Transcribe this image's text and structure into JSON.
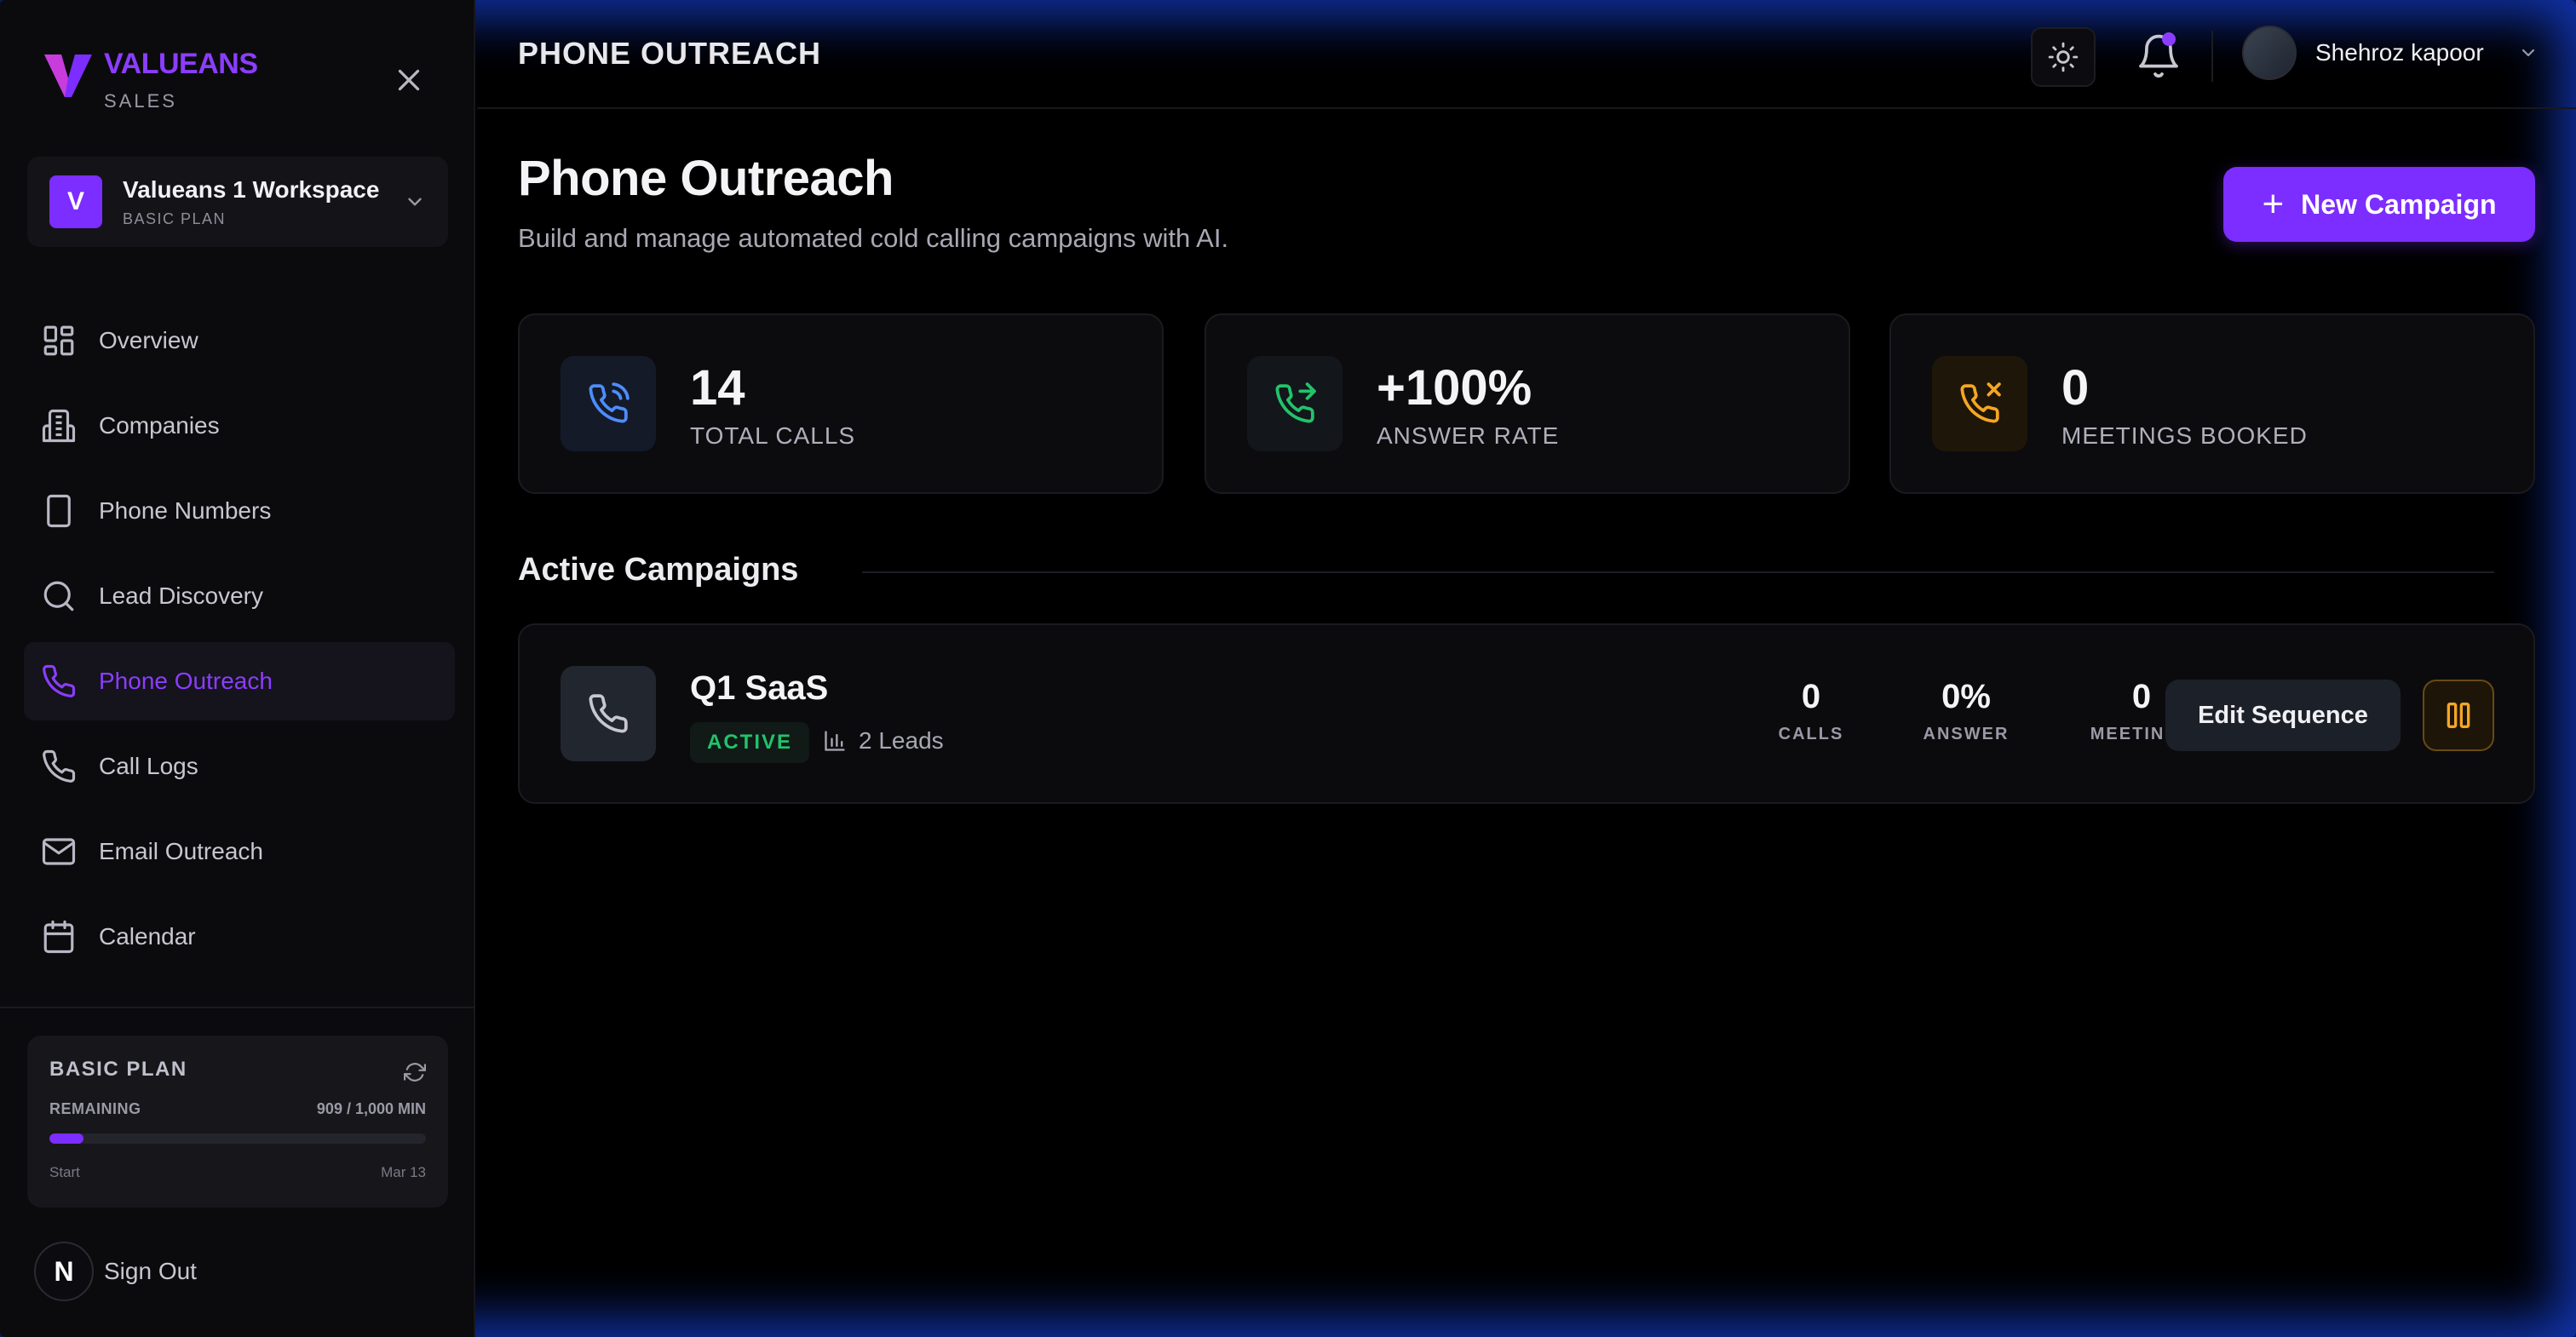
{
  "app": {
    "brand_name": "VALUEANS",
    "brand_sub": "SALES",
    "accent_color": "#7c2dff"
  },
  "workspace": {
    "initial": "V",
    "name": "Valueans 1 Workspace",
    "plan": "BASIC PLAN"
  },
  "nav": {
    "items": [
      {
        "label": "Overview",
        "icon": "grid-icon",
        "active": false
      },
      {
        "label": "Companies",
        "icon": "building-icon",
        "active": false
      },
      {
        "label": "Phone Numbers",
        "icon": "smartphone-icon",
        "active": false
      },
      {
        "label": "Lead Discovery",
        "icon": "search-icon",
        "active": false
      },
      {
        "label": "Phone Outreach",
        "icon": "phone-icon",
        "active": true
      },
      {
        "label": "Call Logs",
        "icon": "phone-icon",
        "active": false
      },
      {
        "label": "Email Outreach",
        "icon": "mail-icon",
        "active": false
      },
      {
        "label": "Calendar",
        "icon": "calendar-icon",
        "active": false
      }
    ]
  },
  "plan_card": {
    "title": "BASIC PLAN",
    "remaining_label": "REMAINING",
    "remaining_value": "909 / 1,000 MIN",
    "usage_fraction": 0.091,
    "start_label": "Start",
    "end_label": "Mar 13"
  },
  "signout": {
    "badge": "N",
    "label": "Sign Out"
  },
  "header": {
    "title": "PHONE OUTREACH",
    "user_name": "Shehroz kapoor"
  },
  "page": {
    "title": "Phone Outreach",
    "subtitle": "Build and manage automated cold calling campaigns with AI.",
    "new_campaign_label": "New Campaign"
  },
  "stats": [
    {
      "value": "14",
      "label": "TOTAL CALLS",
      "icon": "phone-call-icon",
      "color": "#4d8dff"
    },
    {
      "value": "+100%",
      "label": "ANSWER RATE",
      "icon": "phone-forwarded-icon",
      "color": "#22c36b"
    },
    {
      "value": "0",
      "label": "MEETINGS BOOKED",
      "icon": "phone-missed-icon",
      "color": "#f5a623"
    }
  ],
  "campaigns_section": {
    "title": "Active Campaigns"
  },
  "campaigns": [
    {
      "name": "Q1 SaaS",
      "status": "ACTIVE",
      "leads": "2 Leads",
      "calls_value": "0",
      "calls_label": "CALLS",
      "answer_value": "0%",
      "answer_label": "ANSWER",
      "meetings_value": "0",
      "meetings_label": "MEETINGS",
      "edit_label": "Edit Sequence"
    }
  ]
}
